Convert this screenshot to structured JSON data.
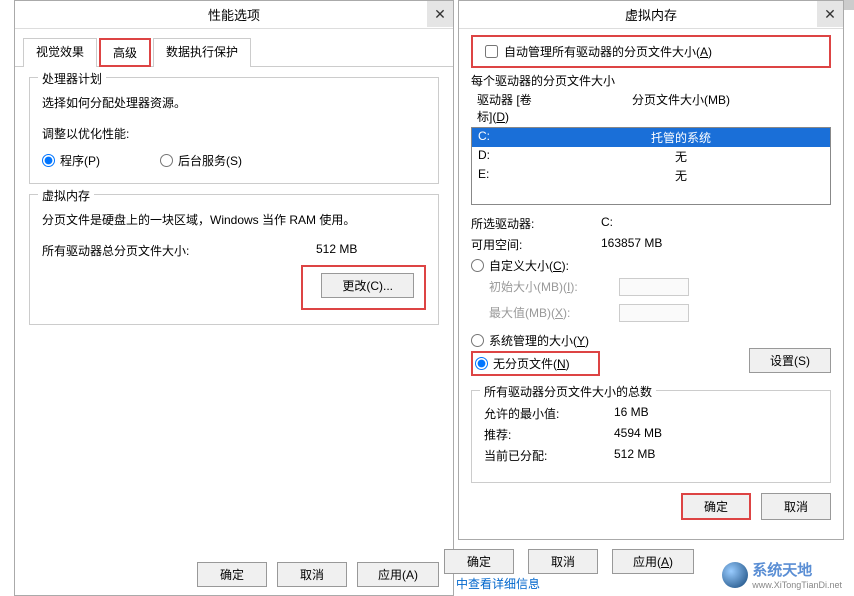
{
  "left": {
    "title": "性能选项",
    "tabs": {
      "visual": "视觉效果",
      "advanced": "高级",
      "dep": "数据执行保护"
    },
    "cpu": {
      "group": "处理器计划",
      "desc": "选择如何分配处理器资源。",
      "adjust": "调整以优化性能:",
      "programs": "程序(P)",
      "background": "后台服务(S)"
    },
    "vm": {
      "group": "虚拟内存",
      "desc": "分页文件是硬盘上的一块区域，Windows 当作 RAM 使用。",
      "totalLabel": "所有驱动器总分页文件大小:",
      "totalValue": "512 MB",
      "change": "更改(C)..."
    },
    "buttons": {
      "ok": "确定",
      "cancel": "取消",
      "apply": "应用(A)"
    }
  },
  "right": {
    "title": "虚拟内存",
    "auto": "自动管理所有驱动器的分页文件大小(A)",
    "perDrive": "每个驱动器的分页文件大小",
    "driveHdr": "驱动器 [卷标](D)",
    "sizeHdr": "分页文件大小(MB)",
    "drives": [
      {
        "name": "C:",
        "size": "托管的系统",
        "sel": true
      },
      {
        "name": "D:",
        "size": "无",
        "sel": false
      },
      {
        "name": "E:",
        "size": "无",
        "sel": false
      }
    ],
    "selDrive": {
      "label": "所选驱动器:",
      "value": "C:"
    },
    "free": {
      "label": "可用空间:",
      "value": "163857 MB"
    },
    "custom": "自定义大小(C):",
    "initLabel": "初始大小(MB)(I):",
    "maxLabel": "最大值(MB)(X):",
    "sysManaged": "系统管理的大小(Y)",
    "noPage": "无分页文件(N)",
    "set": "设置(S)",
    "totalsGroup": "所有驱动器分页文件大小的总数",
    "allowMin": {
      "label": "允许的最小值:",
      "value": "16 MB"
    },
    "recommend": {
      "label": "推荐:",
      "value": "4594 MB"
    },
    "current": {
      "label": "当前已分配:",
      "value": "512 MB"
    },
    "ok": "确定",
    "cancel": "取消"
  },
  "strip": {
    "ok": "确定",
    "cancel": "取消",
    "apply": "应用(A)"
  },
  "link": "中查看详细信息",
  "logo": {
    "main": "系统天地",
    "url": "www.XiTongTianDi.net"
  }
}
